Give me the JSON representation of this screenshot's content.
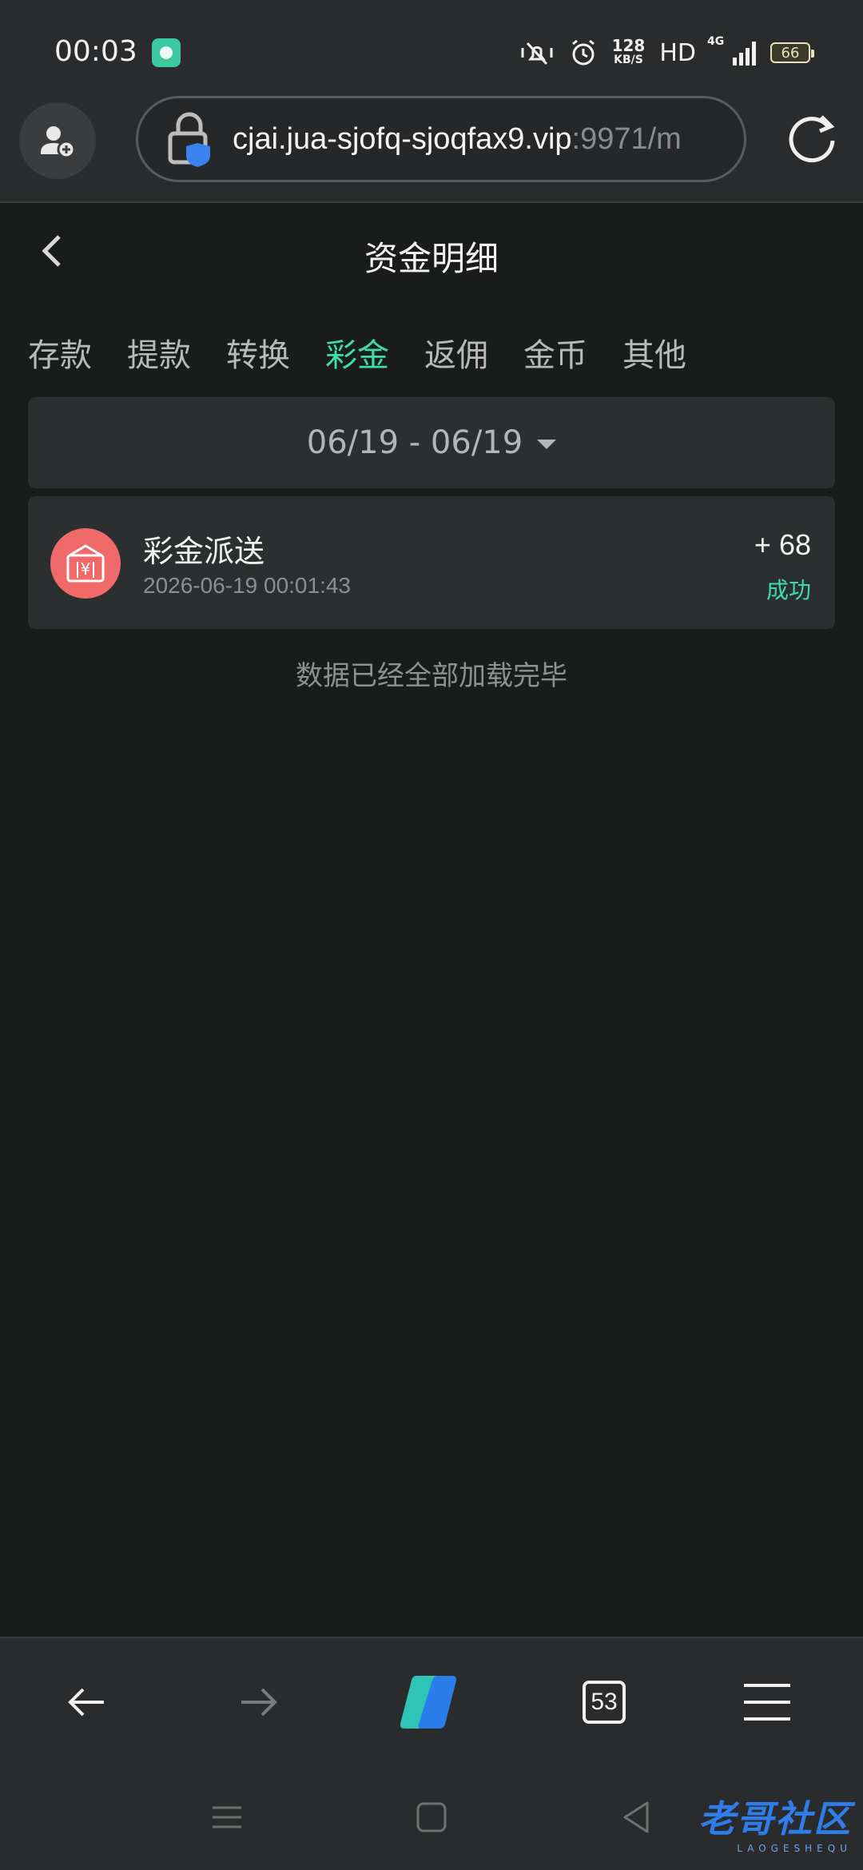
{
  "status_bar": {
    "time": "00:03",
    "speed_value": "128",
    "speed_unit": "KB/S",
    "hd_label": "HD",
    "network_label": "4G",
    "battery": "66"
  },
  "browser": {
    "url_host": "cjai.jua-sjofq-sjoqfax9.vip",
    "url_port": ":9971/m"
  },
  "page": {
    "title": "资金明细"
  },
  "tabs": [
    {
      "label": "存款",
      "active": false
    },
    {
      "label": "提款",
      "active": false
    },
    {
      "label": "转换",
      "active": false
    },
    {
      "label": "彩金",
      "active": true
    },
    {
      "label": "返佣",
      "active": false
    },
    {
      "label": "金币",
      "active": false
    },
    {
      "label": "其他",
      "active": false
    }
  ],
  "date_filter": {
    "range": "06/19 - 06/19"
  },
  "records": [
    {
      "title": "彩金派送",
      "time": "2026-06-19 00:01:43",
      "amount": "+ 68",
      "status": "成功"
    }
  ],
  "end_note": "数据已经全部加载完毕",
  "bottom_nav": {
    "tab_count": "53"
  },
  "watermark": {
    "main": "老哥社区",
    "sub": "LAOGESHEQU"
  },
  "colors": {
    "accent": "#3ddca8",
    "record_icon": "#f06a6a",
    "background": "#1a1c1c"
  }
}
